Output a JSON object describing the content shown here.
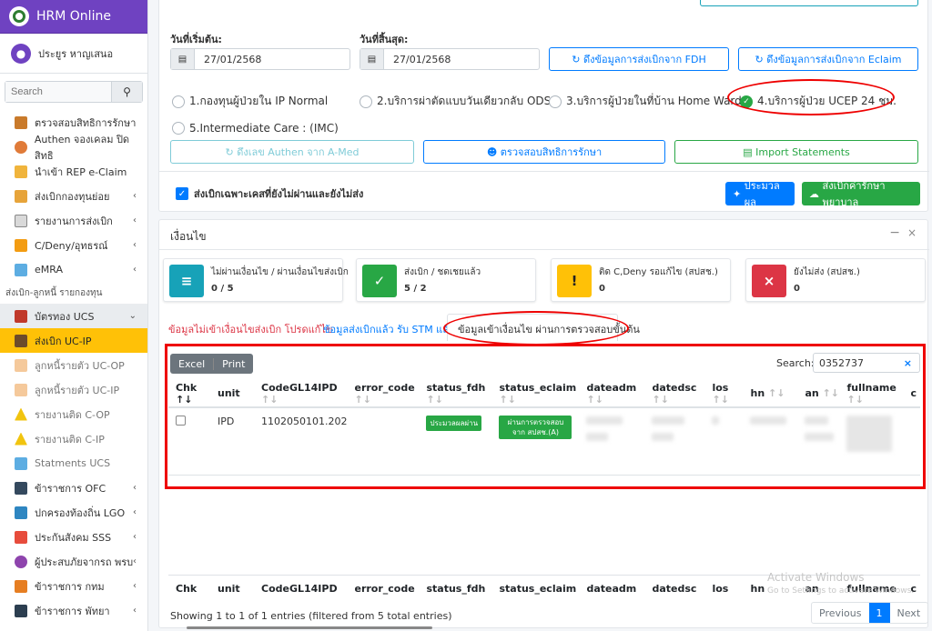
{
  "sidebar": {
    "brand": "HRM Online",
    "user": "ประยูร หาญเสนอ",
    "search_placeholder": "Search",
    "items": [
      {
        "label": "ตรวจสอบสิทธิการรักษา",
        "chev": false
      },
      {
        "label": "Authen จองเคลม ปิดสิทธิ",
        "chev": false
      },
      {
        "label": "นำเข้า REP e-Claim",
        "chev": false
      },
      {
        "label": "ส่งเบิกกองทุนย่อย",
        "chev": true
      },
      {
        "label": "รายงานการส่งเบิก",
        "chev": true
      },
      {
        "label": "C/Deny/อุทธรณ์",
        "chev": true
      },
      {
        "label": "eMRA",
        "chev": true
      }
    ],
    "section_header": "ส่งเบิก-ลูกหนี้ รายกองทุน",
    "ucs_group": "บัตรทอง UCS",
    "sub_items": [
      {
        "label": "ส่งเบิก UC-IP"
      },
      {
        "label": "ลูกหนี้รายตัว UC-OP"
      },
      {
        "label": "ลูกหนี้รายตัว UC-IP"
      },
      {
        "label": "รายงานติด C-OP"
      },
      {
        "label": "รายงานติด C-IP"
      },
      {
        "label": "Statments UCS"
      }
    ],
    "groups": [
      {
        "label": "ข้าราชการ OFC"
      },
      {
        "label": "ปกครองท้องถิ่น LGO"
      },
      {
        "label": "ประกันสังคม SSS"
      },
      {
        "label": "ผู้ประสบภัยจากรถ พรบ"
      },
      {
        "label": "ข้าราชการ กทม"
      },
      {
        "label": "ข้าราชการ พัทยา"
      }
    ]
  },
  "top": {
    "start_label": "วันที่เริ่มต้น:",
    "end_label": "วันที่สิ้นสุด:",
    "start_date": "27/01/2568",
    "end_date": "27/01/2568",
    "btn_fdh": "ดึงข้อมูลการส่งเบิกจาก FDH",
    "btn_eclaim": "ดึงข้อมูลการส่งเบิกจาก Eclaim",
    "radios": [
      "1.กองทุนผู้ป่วยใน IP Normal",
      "2.บริการผ่าตัดแบบวันเดียวกลับ ODS",
      "3.บริการผู้ป่วยในที่บ้าน Home Ward",
      "4.บริการผู้ป่วย UCEP 24 ชม.",
      "5.Intermediate Care : (IMC)"
    ],
    "btn_authen": "ดึงเลข Authen จาก A-Med",
    "btn_check": "ตรวจสอบสิทธิการรักษา",
    "btn_import": "Import Statements",
    "only_unsent": "ส่งเบิกเฉพาะเคสที่ยังไม่ผ่านและยังไม่ส่ง",
    "btn_process": "ประมวลผล",
    "btn_send": "ส่งเบิกค่ารักษาพยาบาล"
  },
  "conditions": {
    "title": "เงื่อนไข",
    "boxes": [
      {
        "title": "ไม่ผ่านเงื่อนไข / ผ่านเงื่อนไขส่งเบิก",
        "value": "0 / 5",
        "color": "#17a2b8",
        "icon": "list-icon"
      },
      {
        "title": "ส่งเบิก / ชดเชยแล้ว",
        "value": "5 / 2",
        "color": "#28a745",
        "icon": "check-icon"
      },
      {
        "title": "ติด C,Deny รอแก้ไข (สปสช.)",
        "value": "0",
        "color": "#ffc107",
        "icon": "exclaim-icon"
      },
      {
        "title": "ยังไม่ส่ง (สปสช.)",
        "value": "0",
        "color": "#dc3545",
        "icon": "x-icon"
      }
    ],
    "tabs": [
      "ข้อมูลไม่เข้าเงื่อนไขส่งเบิก โปรดแก้ไข",
      "ข้อมูลส่งเบิกแล้ว รับ STM แล้ว",
      "ข้อมูลเข้าเงื่อนไข ผ่านการตรวจสอบขั้นต้น"
    ]
  },
  "table": {
    "excel": "Excel",
    "print": "Print",
    "search_label": "Search:",
    "search_value": "0352737",
    "columns": [
      "Chk",
      "unit",
      "CodeGL14IPD",
      "error_code",
      "status_fdh",
      "status_eclaim",
      "dateadm",
      "datedsc",
      "los",
      "hn",
      "an",
      "fullname",
      "c"
    ],
    "row": {
      "unit": "IPD",
      "code": "1102050101.202",
      "status_fdh": "ประมวลผลผ่าน",
      "status_eclaim": "ผ่านการตรวจสอบจาก สปสช.(A)"
    },
    "info": "Showing 1 to 1 of 1 entries (filtered from 5 total entries)",
    "prev": "Previous",
    "page": "1",
    "next": "Next",
    "watermark_1": "Activate Windows",
    "watermark_2": "Go to Settings to activate Windows."
  }
}
